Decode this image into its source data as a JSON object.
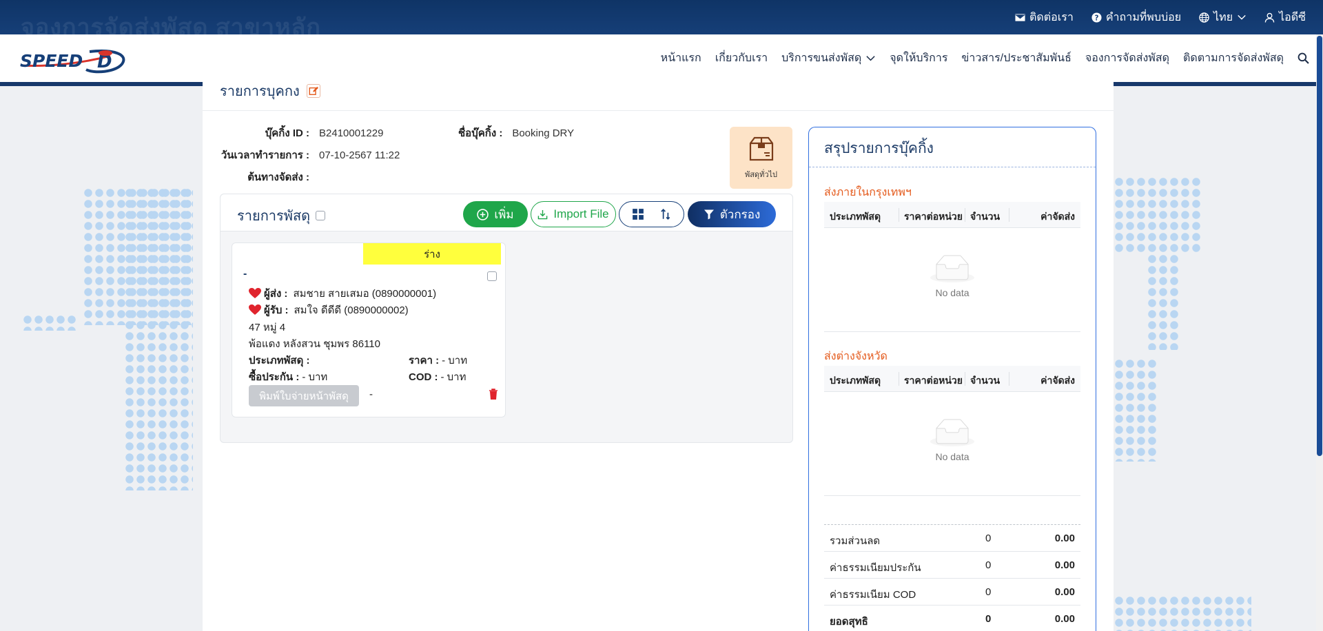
{
  "topbar": {
    "watermark": "จองการจัดส่งพัสดุ สาขาหลัก",
    "contact": "ติดต่อเรา",
    "faq": "คำถามที่พบบ่อย",
    "language": "ไทย",
    "user": "ไอดีซี"
  },
  "nav": {
    "logo_text": "SPEED-D",
    "items": [
      "หน้าแรก",
      "เกี่ยวกับเรา",
      "บริการขนส่งพัสดุ",
      "จุดให้บริการ",
      "ข่าวสาร/ประชาสัมพันธ์",
      "จองการจัดส่งพัสดุ",
      "ติดตามการจัดส่งพัสดุ"
    ]
  },
  "booking": {
    "title": "รายการบุคกง",
    "id_label": "บุ๊คกิ้ง ID :",
    "id_value": "B2410001229",
    "name_label": "ชื่อบุ๊คกิ้ง :",
    "name_value": "Booking DRY",
    "datetime_label": "วันเวลาทำรายการ :",
    "datetime_value": "07-10-2567 11:22",
    "origin_label": "ต้นทางจัดส่ง :",
    "origin_value": "",
    "parcel_type_button": "พัสดุทั่วไป"
  },
  "parcel_list": {
    "title": "รายการพัสดุ",
    "add_label": "เพิ่ม",
    "import_label": "Import File",
    "filter_label": "ตัวกรอง",
    "card": {
      "status": "ร่าง",
      "tracking": "-",
      "sender_label": "ผู้ส่ง :",
      "sender_value": "สมชาย สายเสมอ  (0890000001)",
      "receiver_label": "ผู้รับ :",
      "receiver_value": "สมใจ ดีดีดี  (0890000002)",
      "address_line1": "47 หมู่ 4",
      "address_line2": "พ้อแดง หลังสวน ชุมพร 86110",
      "type_label": "ประเภทพัสดุ :",
      "type_value": "",
      "price_label": "ราคา :",
      "price_value": "- บาท",
      "insurance_label": "ซื้อประกัน :",
      "insurance_value": "- บาท",
      "cod_label": "COD :",
      "cod_value": "- บาท",
      "print_label": "พิมพ์ใบจ่ายหน้าพัสดุ",
      "print_dash": "-"
    }
  },
  "summary": {
    "title": "สรุปรายการบุ๊คกิ้ง",
    "zone1": "ส่งภายในกรุงเทพฯ",
    "zone2": "ส่งต่างจังหวัด",
    "columns": [
      "ประเภทพัสดุ",
      "ราคาต่อหน่วย",
      "จำนวน",
      "ค่าจัดส่ง"
    ],
    "empty_text": "No data",
    "totals": [
      {
        "label": "รวมส่วนลด",
        "count": "0",
        "value": "0.00"
      },
      {
        "label": "ค่าธรรมเนียมประกัน",
        "count": "0",
        "value": "0.00"
      },
      {
        "label": "ค่าธรรมเนียม COD",
        "count": "0",
        "value": "0.00"
      },
      {
        "label": "ยอดสุทธิ",
        "count": "0",
        "value": "0.00"
      }
    ]
  },
  "colors": {
    "navy": "#163f78",
    "green": "#1fa64a",
    "orange_label": "#e45a1c",
    "draft_yellow": "#ffff3d",
    "summary_border": "#2f6ee0"
  }
}
